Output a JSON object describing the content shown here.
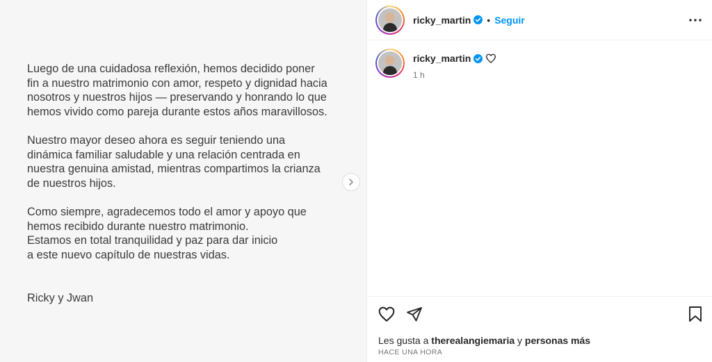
{
  "post": {
    "text_lines": {
      "p1": [
        "Luego de una cuidadosa reflexión, hemos decidido poner",
        "fin a nuestro matrimonio con amor, respeto y dignidad hacia",
        "nosotros y nuestros hijos — preservando y honrando lo que",
        "hemos vivido como pareja durante estos años maravillosos."
      ],
      "p2": [
        "Nuestro mayor deseo ahora es seguir teniendo una",
        "dinámica familiar saludable y una relación centrada en",
        "nuestra genuina amistad, mientras compartimos la crianza",
        "de nuestros hijos."
      ],
      "p3": [
        "Como siempre, agradecemos todo el amor y apoyo que",
        "hemos recibido durante nuestro matrimonio.",
        "Estamos en total tranquilidad y paz para dar inicio",
        "a este nuevo capítulo de nuestras vidas."
      ],
      "signature": "Ricky y Jwan"
    }
  },
  "header": {
    "username": "ricky_martin",
    "separator": "•",
    "follow_label": "Seguir"
  },
  "caption": {
    "username": "ricky_martin",
    "time": "1 h"
  },
  "likes": {
    "prefix": "Les gusta a",
    "user": "therealangiemaria",
    "conj": "y",
    "others": "personas más"
  },
  "timestamp": "HACE UNA HORA",
  "icons": {
    "verified": "verified-badge-icon",
    "more": "more-options-icon",
    "like": "heart-icon",
    "share": "send-icon",
    "save": "bookmark-icon",
    "next": "chevron-right-icon"
  },
  "colors": {
    "accent": "#0095f6",
    "text": "#262626",
    "muted": "#737373"
  }
}
